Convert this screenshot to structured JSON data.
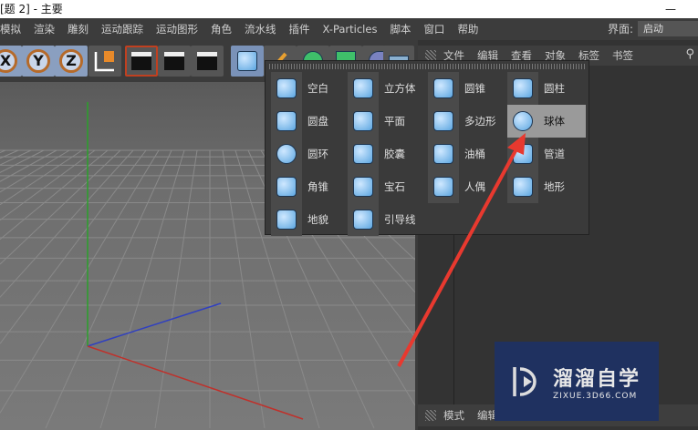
{
  "window": {
    "title": "[题 2] - 主要",
    "minimize": "—"
  },
  "menu": [
    "模拟",
    "渲染",
    "雕刻",
    "运动跟踪",
    "运动图形",
    "角色",
    "流水线",
    "插件",
    "X-Particles",
    "脚本",
    "窗口",
    "帮助"
  ],
  "interface": {
    "label": "界面:",
    "value": "启动"
  },
  "toolbar": {
    "axes": [
      "X",
      "Y",
      "Z"
    ]
  },
  "object_manager": {
    "menu": [
      "文件",
      "编辑",
      "查看",
      "对象",
      "标签",
      "书签"
    ]
  },
  "attribute_manager": {
    "menu": [
      "模式",
      "编辑"
    ]
  },
  "primitives_popup": {
    "items": [
      {
        "label": "空白",
        "icon": "null-icon"
      },
      {
        "label": "立方体",
        "icon": "cube-icon"
      },
      {
        "label": "圆锥",
        "icon": "cone-icon"
      },
      {
        "label": "圆柱",
        "icon": "cylinder-icon"
      },
      {
        "label": "圆盘",
        "icon": "disc-icon"
      },
      {
        "label": "平面",
        "icon": "plane-icon"
      },
      {
        "label": "多边形",
        "icon": "polygon-icon"
      },
      {
        "label": "球体",
        "icon": "sphere-icon",
        "highlighted": true
      },
      {
        "label": "圆环",
        "icon": "torus-icon"
      },
      {
        "label": "胶囊",
        "icon": "capsule-icon"
      },
      {
        "label": "油桶",
        "icon": "oiltank-icon"
      },
      {
        "label": "管道",
        "icon": "tube-icon"
      },
      {
        "label": "角锥",
        "icon": "pyramid-icon"
      },
      {
        "label": "宝石",
        "icon": "platonic-icon"
      },
      {
        "label": "人偶",
        "icon": "figure-icon"
      },
      {
        "label": "地形",
        "icon": "landscape-icon"
      },
      {
        "label": "地貌",
        "icon": "relief-icon"
      },
      {
        "label": "引导线",
        "icon": "guide-icon"
      }
    ]
  },
  "watermark": {
    "title": "溜溜自学",
    "url": "ZIXUE.3D66.COM"
  },
  "colors": {
    "accent_arrow": "#e8392f",
    "axis_x": "#c0302a",
    "axis_y": "#2aa02a",
    "axis_z": "#3040c0"
  }
}
